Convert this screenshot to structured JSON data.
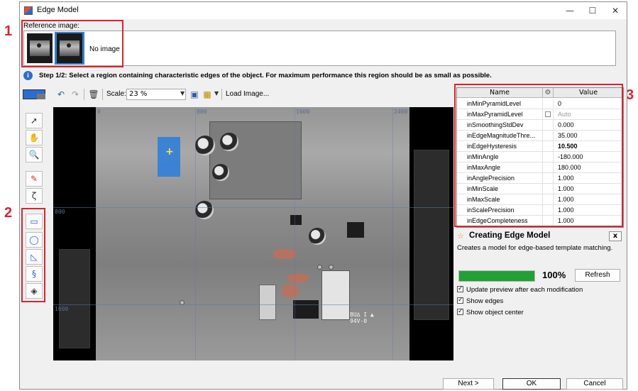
{
  "window": {
    "title": "Edge Model",
    "minimize": "—",
    "maximize": "☐",
    "close": "✕"
  },
  "annotations": [
    "1",
    "2",
    "3"
  ],
  "reference": {
    "label": "Reference image:",
    "no_image": "No image"
  },
  "step": {
    "icon": "i",
    "text": "Step 1/2: Select a region containing characteristic edges of the object. For maximum performance this region should be as small as possible."
  },
  "toolbar": {
    "scale_label": "Scale:",
    "scale_value": "23 %",
    "load_image": "Load Image..."
  },
  "viewport": {
    "coords_top": [
      "0",
      "800",
      "1600",
      "2400"
    ],
    "coords_left": [
      "800",
      "1600"
    ],
    "board_text": "BU∆ I ▲\n94V-0"
  },
  "grid": {
    "col_name": "Name",
    "col_value": "Value",
    "rows": [
      {
        "name": "inMinPyramidLevel",
        "value": "0"
      },
      {
        "name": "inMaxPyramidLevel",
        "value": "Auto",
        "check": true,
        "muted": true
      },
      {
        "name": "inSmoothingStdDev",
        "value": "0.000"
      },
      {
        "name": "inEdgeMagnitudeThre...",
        "value": "35.000"
      },
      {
        "name": "inEdgeHysteresis",
        "value": "10.500",
        "bold": true
      },
      {
        "name": "inMinAngle",
        "value": "-180.000"
      },
      {
        "name": "inMaxAngle",
        "value": "180.000"
      },
      {
        "name": "inAnglePrecision",
        "value": "1.000"
      },
      {
        "name": "inMinScale",
        "value": "1.000"
      },
      {
        "name": "inMaxScale",
        "value": "1.000"
      },
      {
        "name": "inScalePrecision",
        "value": "1.000"
      },
      {
        "name": "inEdgeCompleteness",
        "value": "1.000"
      }
    ]
  },
  "description": {
    "title": "Creating Edge Model",
    "close": "x",
    "text": "Creates a model for edge-based template matching."
  },
  "progress": {
    "percent": 1.0,
    "label": "100%",
    "refresh": "Refresh"
  },
  "options": [
    "Update preview after each modification",
    "Show edges",
    "Show object center"
  ],
  "footer": {
    "next": "Next >",
    "ok": "OK",
    "cancel": "Cancel"
  },
  "colors": {
    "annotation": "#d9232e",
    "selection": "#2a7ddc",
    "progress": "#21a035"
  }
}
